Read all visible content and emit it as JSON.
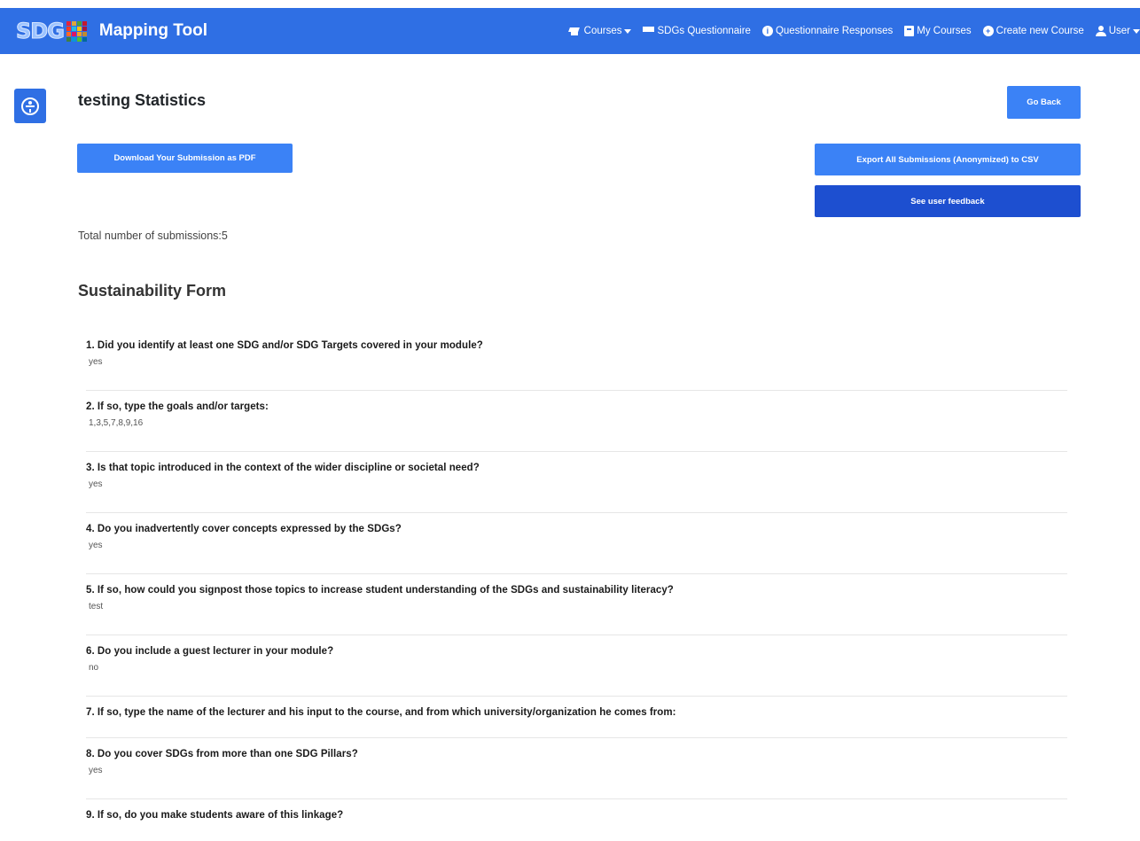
{
  "navbar": {
    "brand_logo": "SDG",
    "brand_title": "Mapping Tool",
    "tile_colors": [
      "#e5243b",
      "#dda63a",
      "#4c9f38",
      "#c5192d",
      "#ff3a21",
      "#26bde2",
      "#fcc30b",
      "#a21942",
      "#fd6925",
      "#dd1367",
      "#fd9d24",
      "#bf8b2e",
      "#3f7e44",
      "#0a97d9",
      "#56c02b",
      "#00689d"
    ],
    "links": [
      {
        "label": "Courses",
        "icon": "graduation-cap-icon",
        "dropdown": true
      },
      {
        "label": "SDGs Questionnaire",
        "icon": "list-icon",
        "dropdown": false
      },
      {
        "label": "Questionnaire Responses",
        "icon": "info-circle-icon",
        "dropdown": false
      },
      {
        "label": "My Courses",
        "icon": "book-icon",
        "dropdown": false
      },
      {
        "label": "Create new Course",
        "icon": "plus-circle-icon",
        "dropdown": false
      },
      {
        "label": "User",
        "icon": "user-icon",
        "dropdown": true
      }
    ]
  },
  "accessibility": {
    "icon": "accessibility-icon"
  },
  "header": {
    "title": "testing Statistics",
    "back_label": "Go Back",
    "download_pdf_label": "Download Your Submission as PDF",
    "export_csv_label": "Export All Submissions (Anonymized) to CSV",
    "feedback_label": "See user feedback"
  },
  "summary": {
    "total_text": "Total number of submissions:5"
  },
  "form": {
    "title": "Sustainability Form",
    "questions": [
      {
        "q": "1. Did you identify at least one SDG and/or SDG Targets covered in your module?",
        "a": "yes"
      },
      {
        "q": "2. If so, type the goals and/or targets:",
        "a": "1,3,5,7,8,9,16"
      },
      {
        "q": "3. Is that topic introduced in the context of the wider discipline or societal need?",
        "a": "yes"
      },
      {
        "q": "4. Do you inadvertently cover concepts expressed by the SDGs?",
        "a": "yes"
      },
      {
        "q": "5. If so, how could you signpost those topics to increase student understanding of the SDGs and sustainability literacy?",
        "a": "test"
      },
      {
        "q": "6. Do you include a guest lecturer in your module?",
        "a": "no"
      },
      {
        "q": "7. If so, type the name of the lecturer and his input to the course, and from which university/organization he comes from:",
        "a": ""
      },
      {
        "q": "8. Do you cover SDGs from more than one SDG Pillars?",
        "a": "yes"
      },
      {
        "q": "9. If so, do you make students aware of this linkage?",
        "a": ""
      }
    ]
  }
}
